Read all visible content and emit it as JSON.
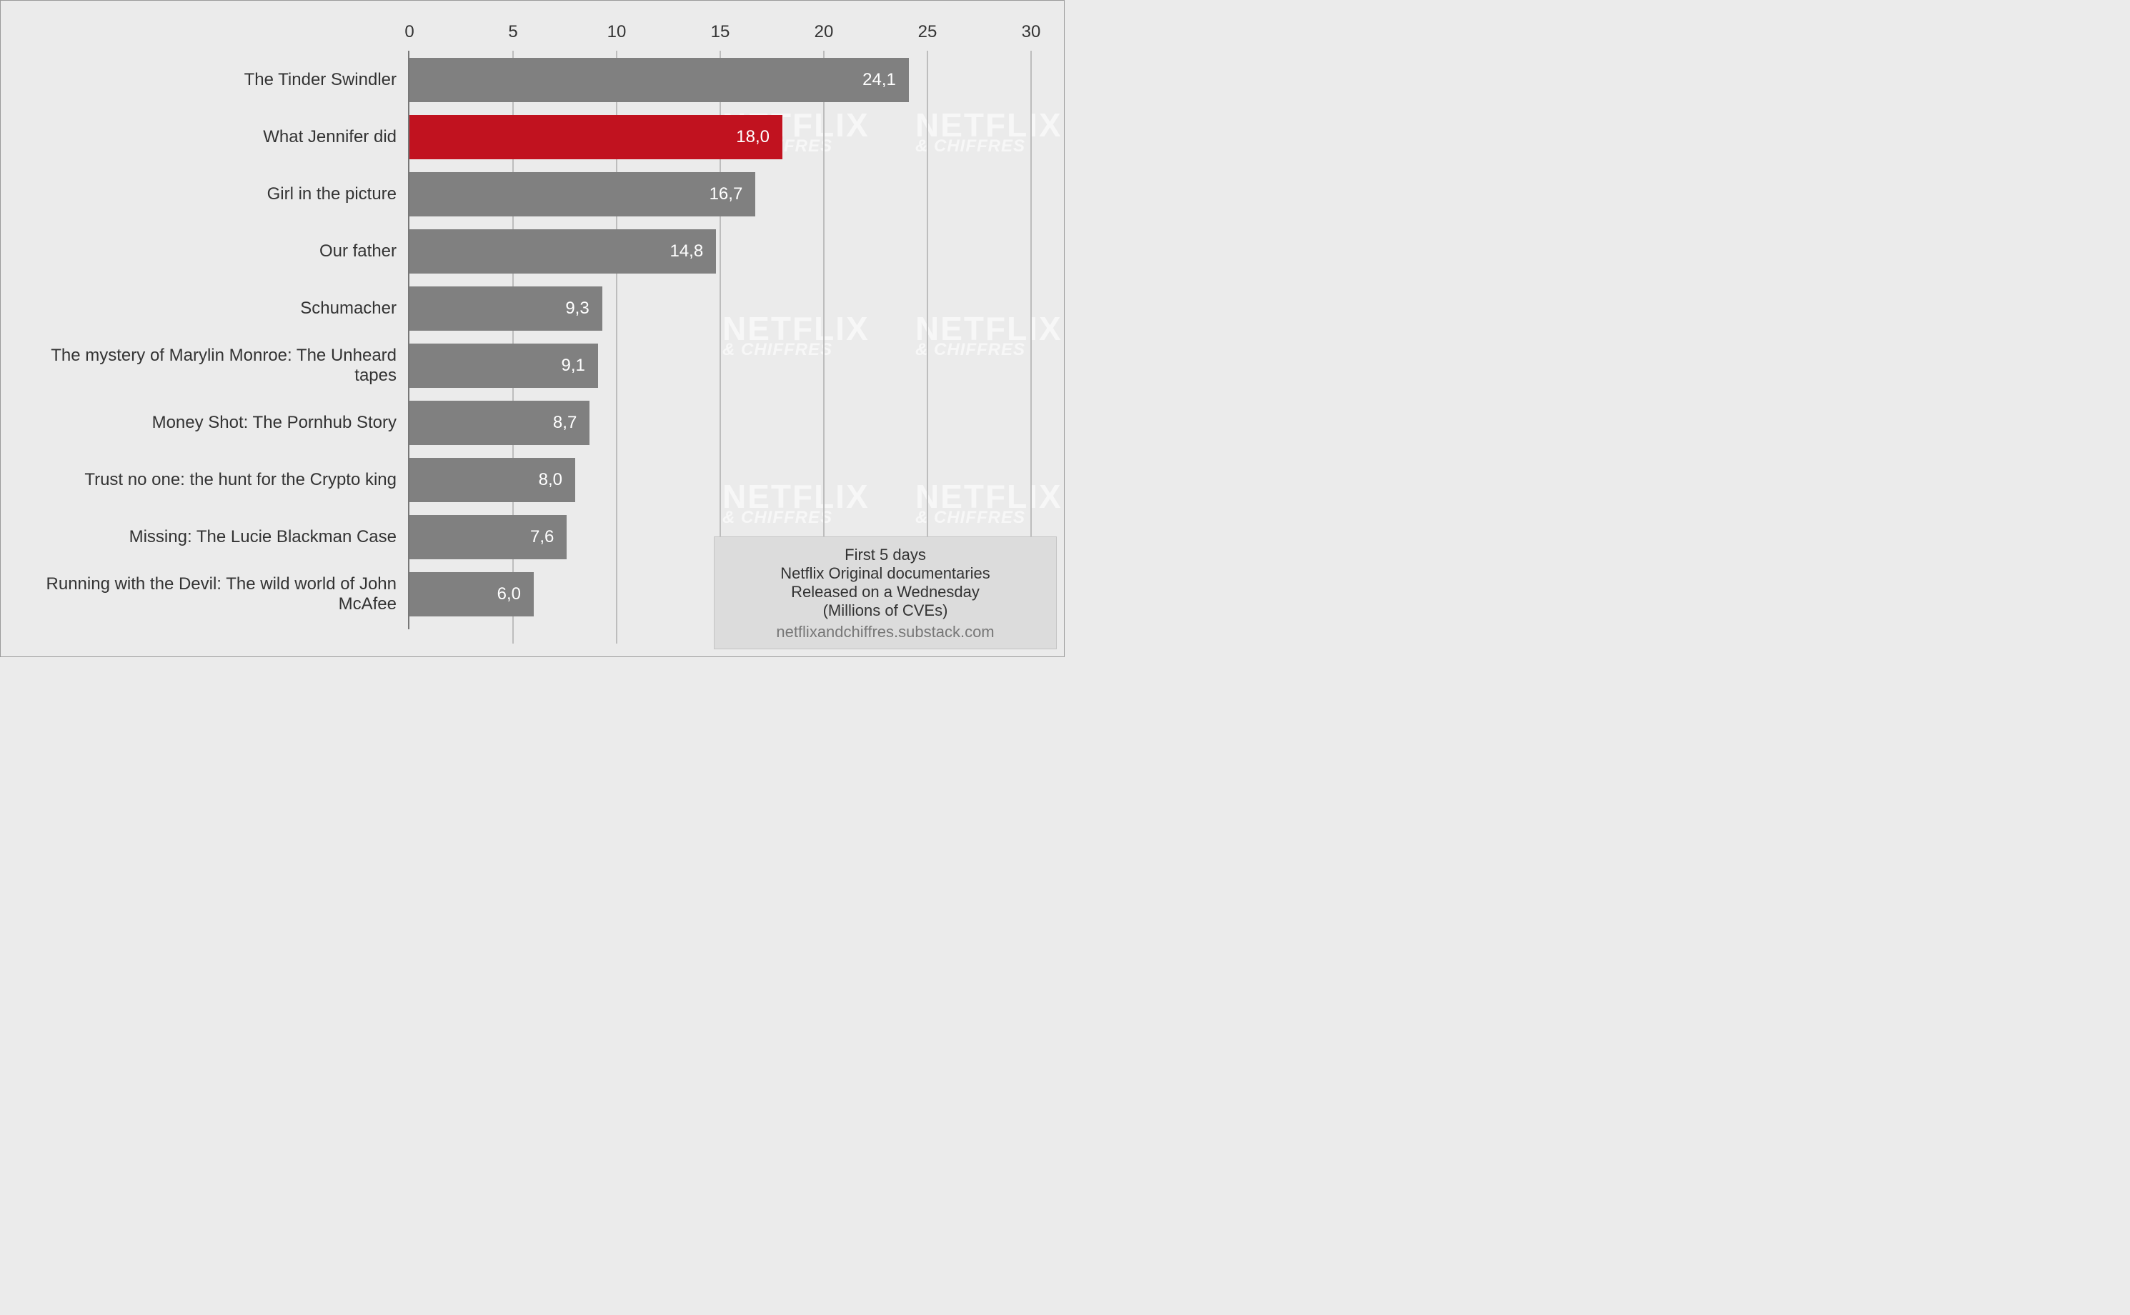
{
  "chart_data": {
    "type": "bar",
    "orientation": "horizontal",
    "categories": [
      "The Tinder Swindler",
      "What Jennifer did",
      "Girl in the picture",
      "Our father",
      "Schumacher",
      "The mystery of Marylin Monroe: The Unheard tapes",
      "Money Shot: The Pornhub Story",
      "Trust no one: the hunt for the Crypto king",
      "Missing: The Lucie Blackman Case",
      "Running with the Devil: The wild world of John McAfee"
    ],
    "values": [
      24.1,
      18.0,
      16.7,
      14.8,
      9.3,
      9.1,
      8.7,
      8.0,
      7.6,
      6.0
    ],
    "value_labels": [
      "24,1",
      "18,0",
      "16,7",
      "14,8",
      "9,3",
      "9,1",
      "8,7",
      "8,0",
      "7,6",
      "6,0"
    ],
    "highlight_index": 1,
    "xlim": [
      0,
      30
    ],
    "xticks": [
      0,
      5,
      10,
      15,
      20,
      25,
      30
    ],
    "xlabel": "",
    "ylabel": "",
    "title": "",
    "caption_lines": [
      "First 5 days",
      "Netflix Original documentaries",
      "Released on a Wednesday",
      "(Millions of CVEs)"
    ],
    "source": "netflixandchiffres.substack.com",
    "watermark": {
      "line1": "NETFLIX",
      "line2": "& CHIFFRES"
    },
    "colors": {
      "bar": "#808080",
      "highlight": "#c1121f",
      "bg": "#ebebeb"
    }
  }
}
